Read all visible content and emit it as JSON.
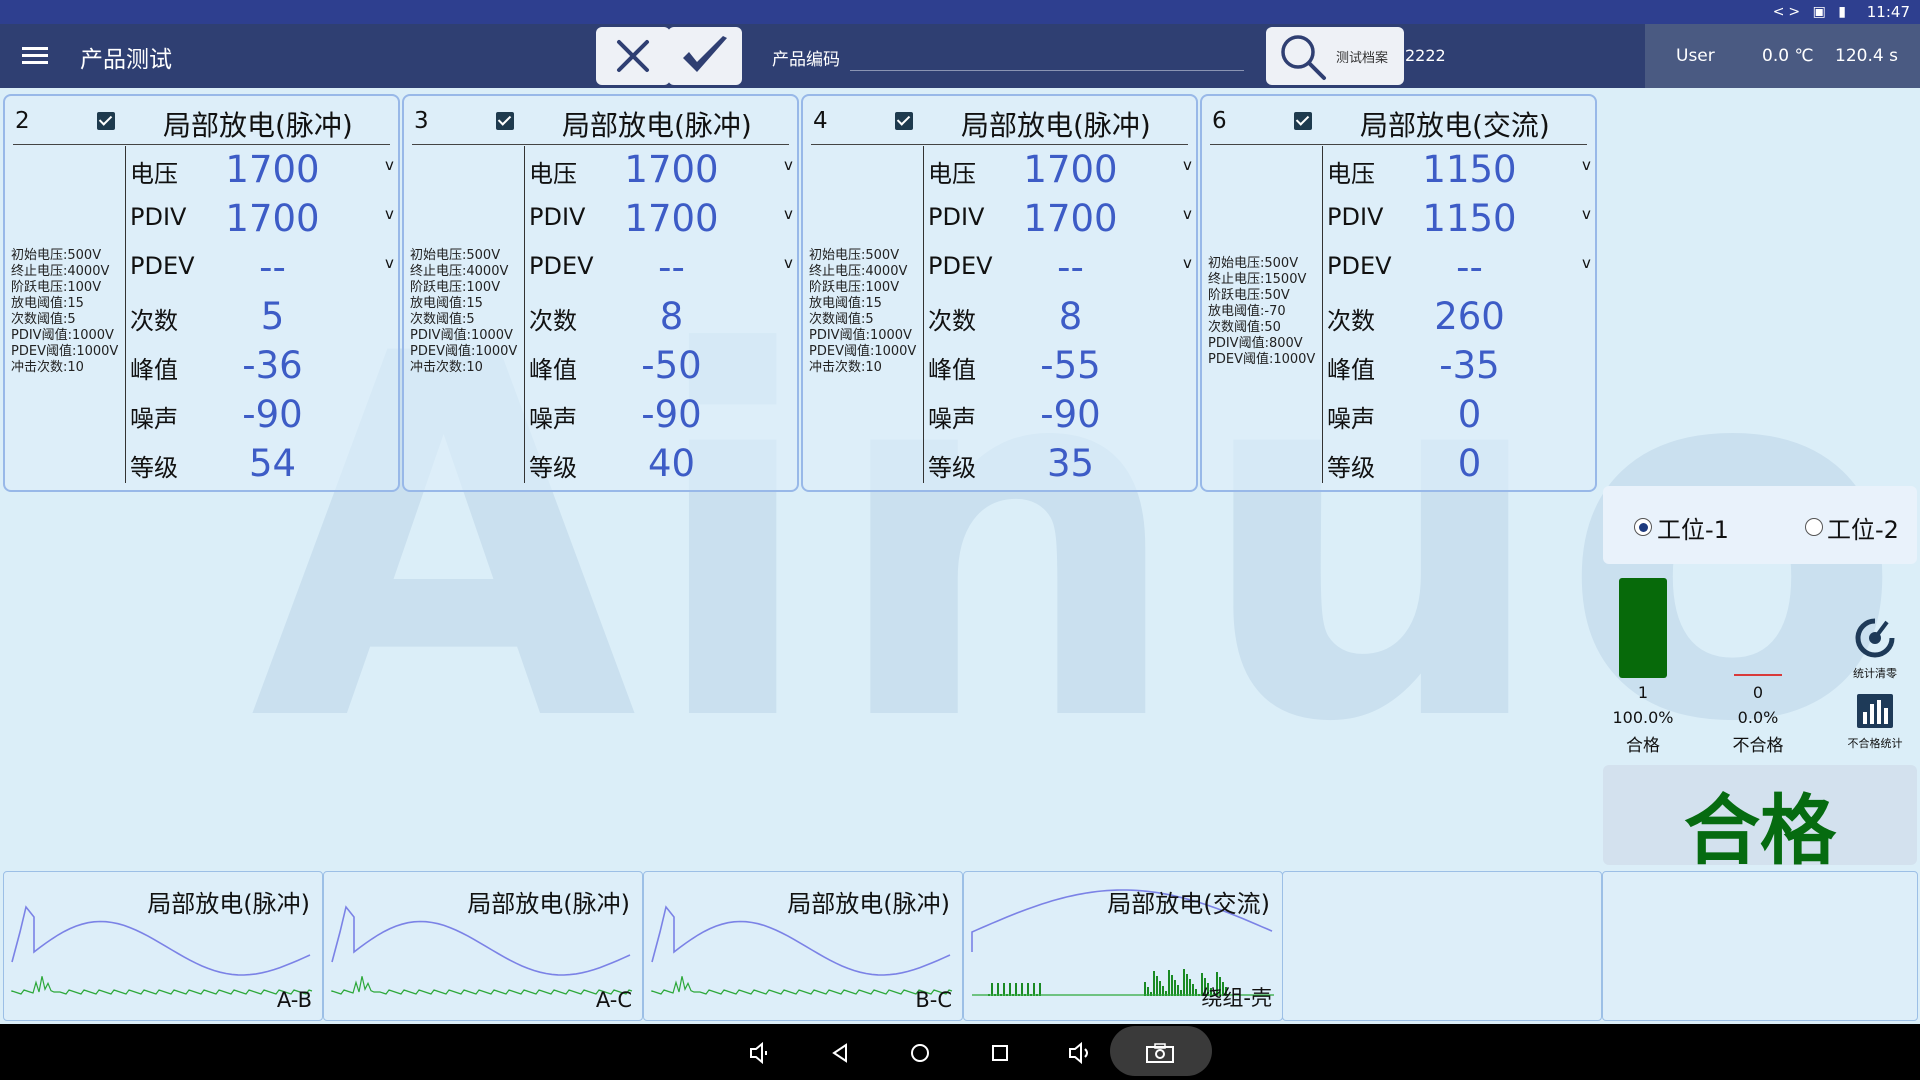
{
  "status_bar": {
    "icons": "<> ▣ ▮",
    "time": "11:47"
  },
  "header": {
    "title": "产品测试",
    "code_label": "产品编码",
    "code_input": "",
    "search_label": "测试档案",
    "code_value": "2222",
    "user": "User",
    "temperature": "0.0 ℃",
    "duration": "120.4 s"
  },
  "watermark": "Ainuo",
  "cards": [
    {
      "num": "2",
      "title": "局部放电(脉冲)",
      "params": [
        "初始电压:500V",
        "终止电压:4000V",
        "阶跃电压:100V",
        "放电阈值:15",
        "次数阈值:5",
        "PDIV阈值:1000V",
        "PDEV阈值:1000V",
        "冲击次数:10"
      ],
      "rows": [
        {
          "label": "电压",
          "value": "1700",
          "unit": "v"
        },
        {
          "label": "PDIV",
          "value": "1700",
          "unit": "v"
        },
        {
          "label": "PDEV",
          "value": "--",
          "unit": "v"
        },
        {
          "label": "次数",
          "value": "5",
          "unit": ""
        },
        {
          "label": "峰值",
          "value": "-36",
          "unit": ""
        },
        {
          "label": "噪声",
          "value": "-90",
          "unit": ""
        },
        {
          "label": "等级",
          "value": "54",
          "unit": ""
        }
      ]
    },
    {
      "num": "3",
      "title": "局部放电(脉冲)",
      "params": [
        "初始电压:500V",
        "终止电压:4000V",
        "阶跃电压:100V",
        "放电阈值:15",
        "次数阈值:5",
        "PDIV阈值:1000V",
        "PDEV阈值:1000V",
        "冲击次数:10"
      ],
      "rows": [
        {
          "label": "电压",
          "value": "1700",
          "unit": "v"
        },
        {
          "label": "PDIV",
          "value": "1700",
          "unit": "v"
        },
        {
          "label": "PDEV",
          "value": "--",
          "unit": "v"
        },
        {
          "label": "次数",
          "value": "8",
          "unit": ""
        },
        {
          "label": "峰值",
          "value": "-50",
          "unit": ""
        },
        {
          "label": "噪声",
          "value": "-90",
          "unit": ""
        },
        {
          "label": "等级",
          "value": "40",
          "unit": ""
        }
      ]
    },
    {
      "num": "4",
      "title": "局部放电(脉冲)",
      "params": [
        "初始电压:500V",
        "终止电压:4000V",
        "阶跃电压:100V",
        "放电阈值:15",
        "次数阈值:5",
        "PDIV阈值:1000V",
        "PDEV阈值:1000V",
        "冲击次数:10"
      ],
      "rows": [
        {
          "label": "电压",
          "value": "1700",
          "unit": "v"
        },
        {
          "label": "PDIV",
          "value": "1700",
          "unit": "v"
        },
        {
          "label": "PDEV",
          "value": "--",
          "unit": "v"
        },
        {
          "label": "次数",
          "value": "8",
          "unit": ""
        },
        {
          "label": "峰值",
          "value": "-55",
          "unit": ""
        },
        {
          "label": "噪声",
          "value": "-90",
          "unit": ""
        },
        {
          "label": "等级",
          "value": "35",
          "unit": ""
        }
      ]
    },
    {
      "num": "6",
      "title": "局部放电(交流)",
      "params": [
        "初始电压:500V",
        "终止电压:1500V",
        "阶跃电压:50V",
        "放电阈值:-70",
        "次数阈值:50",
        "PDIV阈值:800V",
        "PDEV阈值:1000V"
      ],
      "rows": [
        {
          "label": "电压",
          "value": "1150",
          "unit": "v"
        },
        {
          "label": "PDIV",
          "value": "1150",
          "unit": "v"
        },
        {
          "label": "PDEV",
          "value": "--",
          "unit": "v"
        },
        {
          "label": "次数",
          "value": "260",
          "unit": ""
        },
        {
          "label": "峰值",
          "value": "-35",
          "unit": ""
        },
        {
          "label": "噪声",
          "value": "0",
          "unit": ""
        },
        {
          "label": "等级",
          "value": "0",
          "unit": ""
        }
      ]
    }
  ],
  "station": {
    "option1": "工位-1",
    "option2": "工位-2",
    "selected": "工位-1"
  },
  "stats": {
    "pass_count": "1",
    "pass_pct": "100.0%",
    "pass_label": "合格",
    "fail_count": "0",
    "fail_pct": "0.0%",
    "fail_label": "不合格",
    "clear_label": "统计清零",
    "fail_stats_label": "不合格统计"
  },
  "result": "合格",
  "waves": [
    {
      "title": "局部放电(脉冲)",
      "label": "A-B"
    },
    {
      "title": "局部放电(脉冲)",
      "label": "A-C"
    },
    {
      "title": "局部放电(脉冲)",
      "label": "B-C"
    },
    {
      "title": "局部放电(交流)",
      "label": "绕组-壳"
    }
  ],
  "colors": {
    "topbar": "#2f3f72",
    "value_blue": "#3d5cc6",
    "pass_green": "#076a0a",
    "fail_red": "#d93a3a",
    "wave_blue": "#7b82e6",
    "wave_green": "#2da83a"
  }
}
